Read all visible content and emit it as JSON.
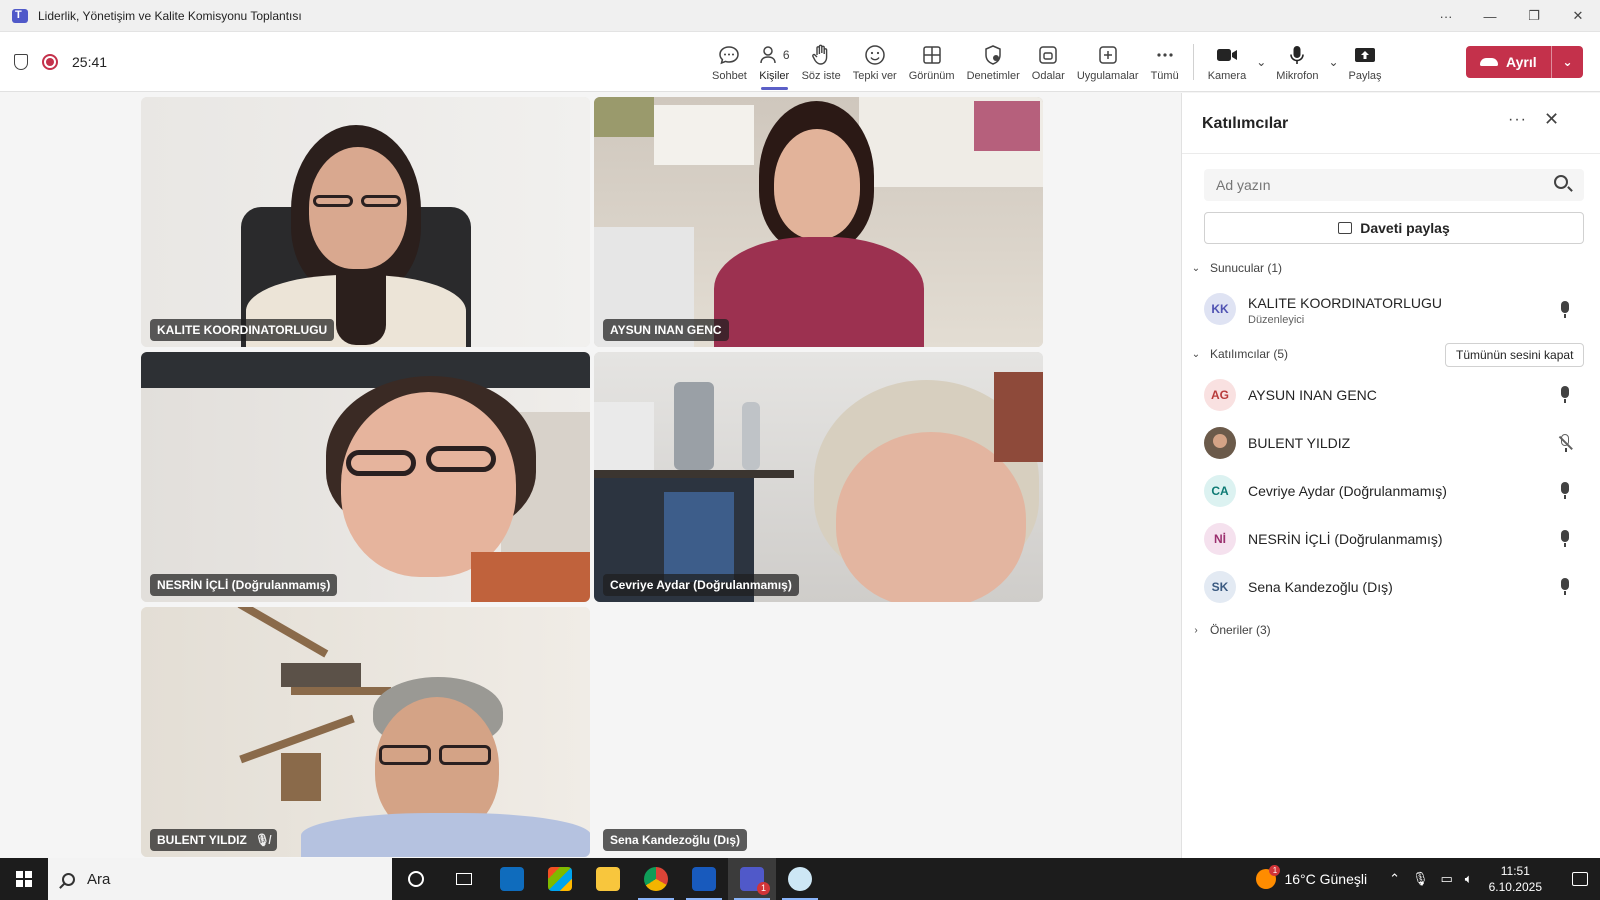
{
  "window": {
    "title": "Liderlik, Yönetişim ve Kalite Komisyonu Toplantısı",
    "controls": [
      "···",
      "—",
      "❐",
      "✕"
    ]
  },
  "toolbar": {
    "timer": "25:41",
    "items": [
      {
        "label": "Sohbet",
        "icon": "chat-icon"
      },
      {
        "label": "Kişiler",
        "icon": "people-icon",
        "count": "6",
        "active": true
      },
      {
        "label": "Söz iste",
        "icon": "hand-icon"
      },
      {
        "label": "Tepki ver",
        "icon": "smile-icon"
      },
      {
        "label": "Görünüm",
        "icon": "grid-icon"
      },
      {
        "label": "Denetimler",
        "icon": "shield-gear-icon"
      },
      {
        "label": "Odalar",
        "icon": "rooms-icon"
      },
      {
        "label": "Uygulamalar",
        "icon": "plus-icon"
      },
      {
        "label": "Tümü",
        "icon": "more-icon"
      }
    ],
    "camera_label": "Kamera",
    "mic_label": "Mikrofon",
    "share_label": "Paylaş",
    "leave_label": "Ayrıl"
  },
  "tiles": [
    {
      "name": "KALITE KOORDINATORLUGU",
      "muted": false
    },
    {
      "name": "AYSUN INAN GENC",
      "muted": false
    },
    {
      "name": "NESRİN İÇLİ (Doğrulanmamış)",
      "muted": false
    },
    {
      "name": "Cevriye Aydar (Doğrulanmamış)",
      "muted": false
    },
    {
      "name": "BULENT YILDIZ",
      "muted": true
    },
    {
      "name": "Sena Kandezoğlu (Dış)",
      "muted": false
    }
  ],
  "panel": {
    "title": "Katılımcılar",
    "search_placeholder": "Ad yazın",
    "share_invite": "Daveti paylaş",
    "presenters_header": "Sunucular (1)",
    "attendees_header": "Katılımcılar (5)",
    "mute_all": "Tümünün sesini kapat",
    "suggestions_header": "Öneriler (3)",
    "presenters": [
      {
        "initials": "KK",
        "name": "KALITE KOORDINATORLUGU",
        "role": "Düzenleyici",
        "color": "#dfe3f3",
        "text_color": "#4f52b2",
        "muted": false
      }
    ],
    "attendees": [
      {
        "initials": "AG",
        "name": "AYSUN INAN GENC",
        "color": "#f9e1e1",
        "text_color": "#b83c3c",
        "muted": false
      },
      {
        "initials": "",
        "name": "BULENT YILDIZ",
        "color": "#6b5a4a",
        "text_color": "#ffffff",
        "muted": true
      },
      {
        "initials": "CA",
        "name": "Cevriye Aydar (Doğrulanmamış)",
        "color": "#dcf2f1",
        "text_color": "#0e7a74",
        "muted": false
      },
      {
        "initials": "Nİ",
        "name": "NESRİN İÇLİ (Doğrulanmamış)",
        "color": "#f5e1ee",
        "text_color": "#9b2f6e",
        "muted": false
      },
      {
        "initials": "SK",
        "name": "Sena Kandezoğlu (Dış)",
        "color": "#e3eaf3",
        "text_color": "#3b5a80",
        "muted": false
      }
    ]
  },
  "taskbar": {
    "search_label": "Ara",
    "weather": "16°C  Güneşli",
    "weather_badge": "1",
    "teams_badge": "1",
    "time": "11:51",
    "date": "6.10.2025"
  }
}
